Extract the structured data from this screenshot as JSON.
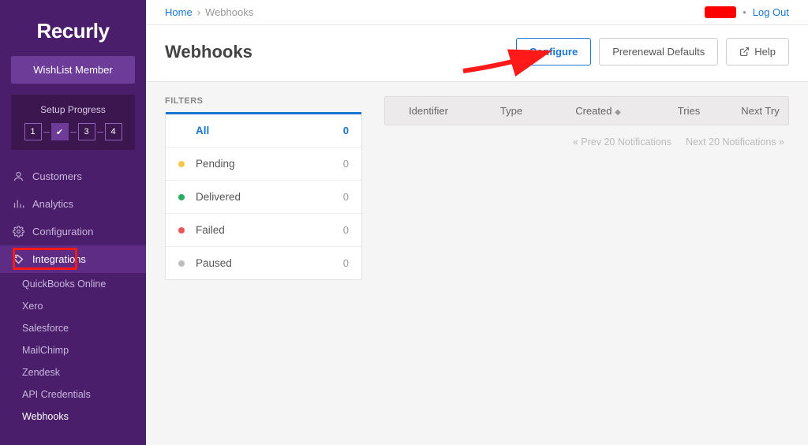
{
  "logo": "Recurly",
  "member_box": "WishList Member",
  "setup": {
    "title": "Setup Progress",
    "steps": [
      "1",
      "✔",
      "3",
      "4"
    ]
  },
  "nav": {
    "customers": "Customers",
    "analytics": "Analytics",
    "configuration": "Configuration",
    "integrations": "Integrations",
    "sub": {
      "quickbooks": "QuickBooks Online",
      "xero": "Xero",
      "salesforce": "Salesforce",
      "mailchimp": "MailChimp",
      "zendesk": "Zendesk",
      "api": "API Credentials",
      "webhooks": "Webhooks"
    }
  },
  "breadcrumb": {
    "home": "Home",
    "current": "Webhooks"
  },
  "logout": "Log Out",
  "page_title": "Webhooks",
  "buttons": {
    "configure": "Configure",
    "prerenewal": "Prerenewal Defaults",
    "help": "Help"
  },
  "filters_label": "FILTERS",
  "filters": [
    {
      "name": "All",
      "count": "0",
      "dot": "none",
      "active": true
    },
    {
      "name": "Pending",
      "count": "0",
      "dot": "yellow"
    },
    {
      "name": "Delivered",
      "count": "0",
      "dot": "green"
    },
    {
      "name": "Failed",
      "count": "0",
      "dot": "red"
    },
    {
      "name": "Paused",
      "count": "0",
      "dot": "grey"
    }
  ],
  "table_headers": {
    "identifier": "Identifier",
    "type": "Type",
    "created": "Created",
    "tries": "Tries",
    "next": "Next Try"
  },
  "paging": {
    "prev": "« Prev 20 Notifications",
    "next": "Next 20 Notifications »"
  }
}
